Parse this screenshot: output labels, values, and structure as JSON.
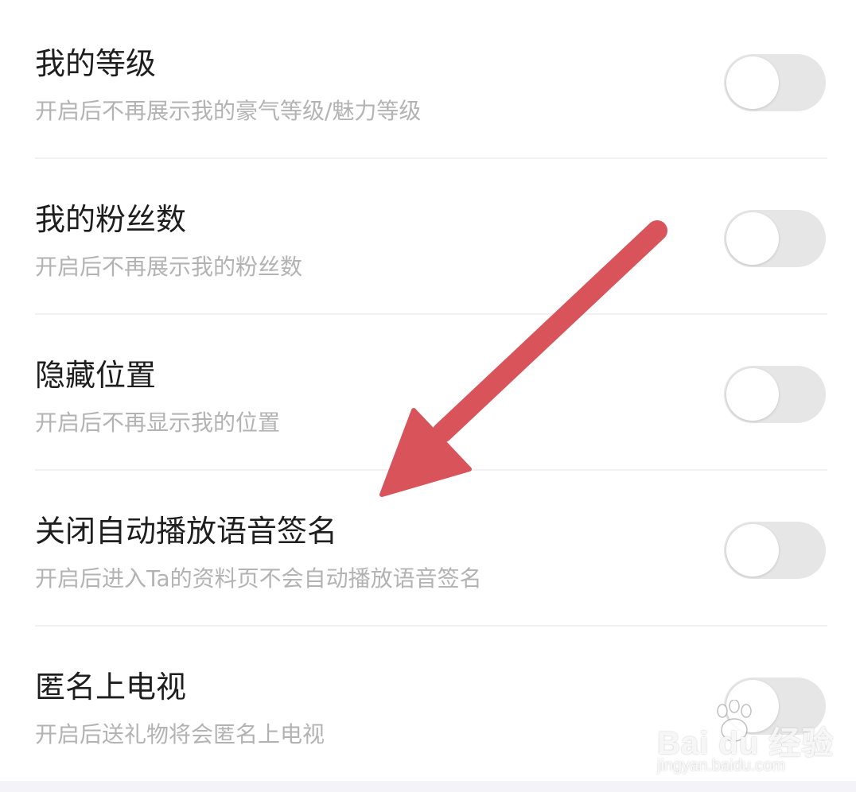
{
  "settings": [
    {
      "title": "我的等级",
      "description": "开启后不再展示我的豪气等级/魅力等级",
      "enabled": false
    },
    {
      "title": "我的粉丝数",
      "description": "开启后不再展示我的粉丝数",
      "enabled": false
    },
    {
      "title": "隐藏位置",
      "description": "开启后不再显示我的位置",
      "enabled": false
    },
    {
      "title": "关闭自动播放语音签名",
      "description": "开启后进入Ta的资料页不会自动播放语音签名",
      "enabled": false
    },
    {
      "title": "匿名上电视",
      "description": "开启后送礼物将会匿名上电视",
      "enabled": false
    }
  ],
  "watermark": {
    "logo": "Bai du 经验",
    "url": "jingyan.baidu.com"
  },
  "colors": {
    "toggle_off": "#e6e6e6",
    "arrow": "#d9535b",
    "title_text": "#1e1e1e",
    "desc_text": "#b3b3b3"
  }
}
